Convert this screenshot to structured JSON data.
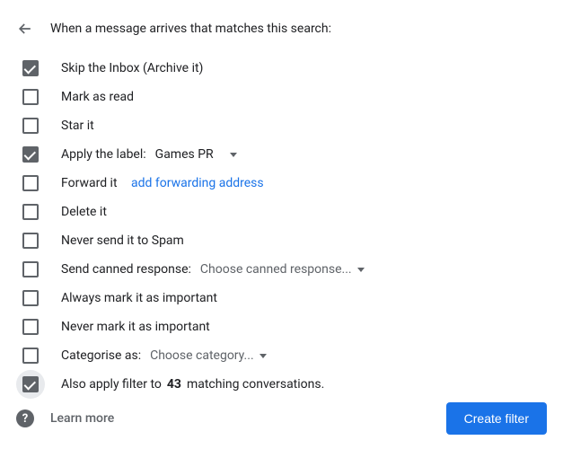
{
  "header": {
    "title": "When a message arrives that matches this search:"
  },
  "options": {
    "skip_inbox": {
      "label": "Skip the Inbox (Archive it)",
      "checked": true
    },
    "mark_read": {
      "label": "Mark as read",
      "checked": false
    },
    "star_it": {
      "label": "Star it",
      "checked": false
    },
    "apply_label": {
      "label": "Apply the label:",
      "value": "Games PR",
      "checked": true
    },
    "forward_it": {
      "label": "Forward it",
      "link": "add forwarding address",
      "checked": false
    },
    "delete_it": {
      "label": "Delete it",
      "checked": false
    },
    "never_spam": {
      "label": "Never send it to Spam",
      "checked": false
    },
    "canned": {
      "label": "Send canned response:",
      "value": "Choose canned response...",
      "checked": false
    },
    "always_important": {
      "label": "Always mark it as important",
      "checked": false
    },
    "never_important": {
      "label": "Never mark it as important",
      "checked": false
    },
    "categorise": {
      "label": "Categorise as:",
      "value": "Choose category...",
      "checked": false
    },
    "also_apply": {
      "prefix": "Also apply filter to ",
      "count": "43",
      "suffix": " matching conversations.",
      "checked": true
    }
  },
  "footer": {
    "learn_more": "Learn more",
    "create_filter": "Create filter"
  }
}
